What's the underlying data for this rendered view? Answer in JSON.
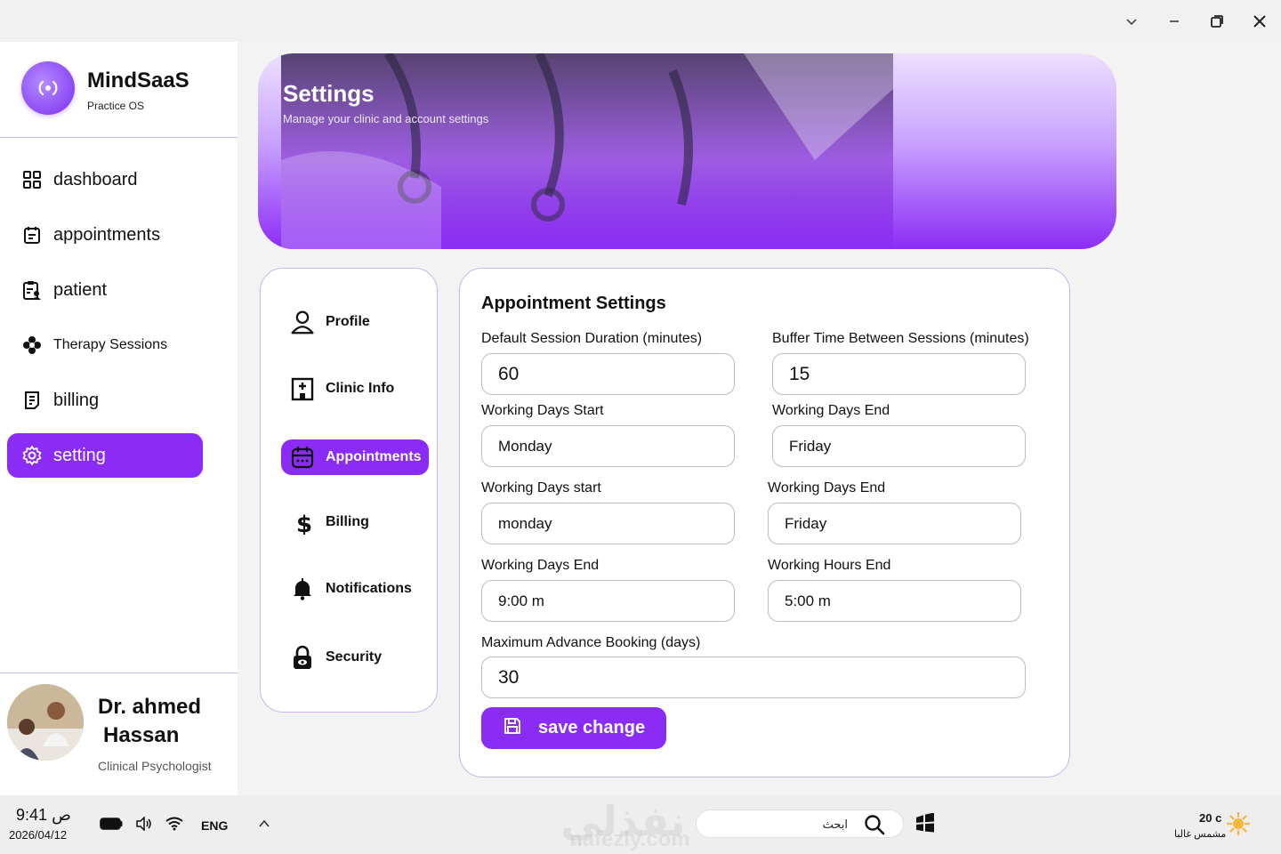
{
  "window": {
    "controls": [
      "chevron-down-icon",
      "minimize-icon",
      "restore-icon",
      "close-icon"
    ]
  },
  "brand": {
    "name": "MindSaaS",
    "tagline": "Practice OS"
  },
  "sidebar": {
    "items": [
      {
        "label": "dashboard",
        "icon": "grid-icon"
      },
      {
        "label": "appointments",
        "icon": "calendar-icon"
      },
      {
        "label": "patient",
        "icon": "clipboard-user-icon"
      },
      {
        "label": "Therapy Sessions",
        "icon": "flower-icon"
      },
      {
        "label": "billing",
        "icon": "receipt-icon"
      },
      {
        "label": "setting",
        "icon": "gear-icon",
        "active": true
      }
    ]
  },
  "user": {
    "first_line": "Dr. ahmed",
    "second_line": "Hassan",
    "role": "Clinical Psychologist"
  },
  "hero": {
    "title": "Settings",
    "subtitle": "Manage your clinic and account settings"
  },
  "tabs": [
    {
      "label": "Profile",
      "icon": "user-icon"
    },
    {
      "label": "Clinic Info",
      "icon": "hospital-icon"
    },
    {
      "label": "Appointments",
      "icon": "calendar-icon",
      "active": true
    },
    {
      "label": "Billing",
      "icon": "dollar-icon"
    },
    {
      "label": "Notifications",
      "icon": "bell-icon"
    },
    {
      "label": "Security",
      "icon": "lock-icon"
    }
  ],
  "form": {
    "title": "Appointment Settings",
    "fields": {
      "session_duration": {
        "label": "Default Session Duration (minutes)",
        "value": "60"
      },
      "buffer_time": {
        "label": "Buffer Time Between Sessions (minutes)",
        "value": "15"
      },
      "working_days_start_1": {
        "label": "Working Days Start",
        "value": "Monday"
      },
      "working_days_end_1": {
        "label": "Working Days End",
        "value": "Friday"
      },
      "working_days_start_2": {
        "label": "Working Days start",
        "value": "monday"
      },
      "working_days_end_2": {
        "label": "Working Days End",
        "value": "Friday"
      },
      "working_days_end_3": {
        "label": "Working Days End",
        "value": "9:00 m"
      },
      "working_hours_end": {
        "label": "Working Hours End",
        "value": "5:00 m"
      },
      "max_advance_booking": {
        "label": "Maximum Advance Booking (days)",
        "value": "30"
      }
    },
    "save_label": "save change"
  },
  "taskbar": {
    "time": "9:41",
    "ampm": "ص",
    "date": "2026/04/12",
    "language": "ENG",
    "search_text": "ابحث",
    "weather_temp": "20 c",
    "weather_desc": "مشمس غالبا",
    "watermark": "نفذلي",
    "watermark_sub": "nafezly.com"
  },
  "colors": {
    "accent": "#8a2cf5",
    "border": "#c9b4f0"
  }
}
